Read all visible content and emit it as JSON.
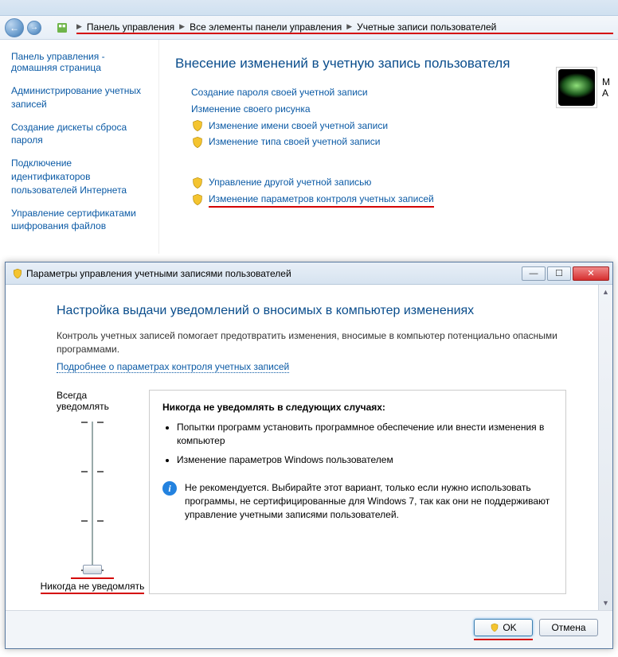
{
  "breadcrumb": {
    "items": [
      "Панель управления",
      "Все элементы панели управления",
      "Учетные записи пользователей"
    ]
  },
  "sidebar": {
    "home_line1": "Панель управления -",
    "home_line2": "домашняя страница",
    "links": [
      "Администрирование учетных записей",
      "Создание дискеты сброса пароля",
      "Подключение идентификаторов пользователей Интернета",
      "Управление сертификатами шифрования файлов"
    ]
  },
  "main": {
    "title": "Внесение изменений в учетную запись пользователя",
    "links_plain": [
      "Создание пароля своей учетной записи",
      "Изменение своего рисунка"
    ],
    "links_shield": [
      "Изменение имени своей учетной записи",
      "Изменение типа своей учетной записи"
    ],
    "links_shield2": [
      "Управление другой учетной записью",
      "Изменение параметров контроля учетных записей"
    ],
    "account_name": "M",
    "account_role": "А"
  },
  "uac": {
    "window_title": "Параметры управления учетными записями пользователей",
    "heading": "Настройка выдачи уведомлений о вносимых в компьютер изменениях",
    "desc": "Контроль учетных записей помогает предотвратить изменения, вносимые в компьютер потенциально опасными программами.",
    "more_link": "Подробнее о параметрах контроля учетных записей",
    "slider_top": "Всегда уведомлять",
    "slider_bottom": "Никогда не уведомлять",
    "info_title": "Никогда не уведомлять в следующих случаях:",
    "info_items": [
      "Попытки программ установить программное обеспечение или внести изменения в компьютер",
      "Изменение параметров Windows пользователем"
    ],
    "info_note": "Не рекомендуется. Выбирайте этот вариант, только если нужно использовать программы, не сертифицированные для Windows 7, так как они не поддерживают управление учетными записями пользователей.",
    "ok": "OK",
    "cancel": "Отмена"
  }
}
